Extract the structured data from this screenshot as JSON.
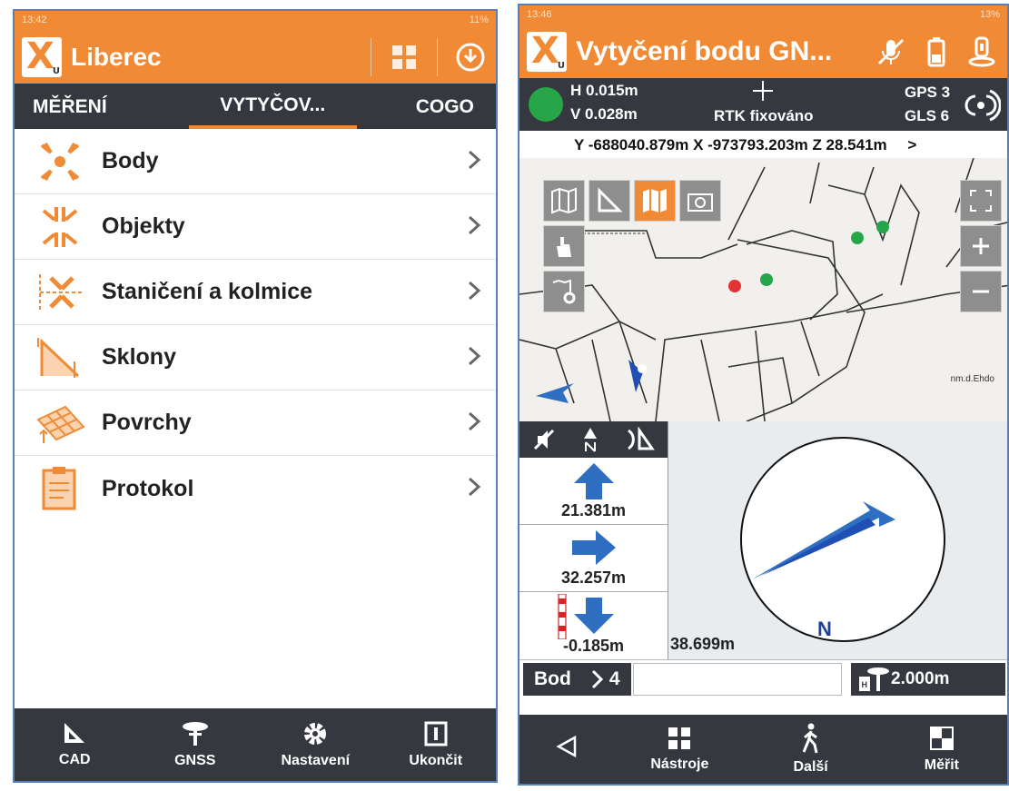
{
  "phone_a": {
    "status": {
      "time": "13:42",
      "battery": "11%"
    },
    "app": {
      "title": "Liberec"
    },
    "tabs": [
      {
        "label": "MĚŘENÍ"
      },
      {
        "label": "VYTYČOV..."
      },
      {
        "label": "COGO"
      }
    ],
    "menu": [
      {
        "label": "Body",
        "icon": "points-icon"
      },
      {
        "label": "Objekty",
        "icon": "objects-icon"
      },
      {
        "label": "Staničení a kolmice",
        "icon": "chainage-icon"
      },
      {
        "label": "Sklony",
        "icon": "slopes-icon"
      },
      {
        "label": "Povrchy",
        "icon": "surfaces-icon"
      },
      {
        "label": "Protokol",
        "icon": "report-icon"
      }
    ],
    "bottom": [
      {
        "label": "CAD"
      },
      {
        "label": "GNSS"
      },
      {
        "label": "Nastavení"
      },
      {
        "label": "Ukončit"
      }
    ]
  },
  "phone_b": {
    "status": {
      "time": "13:46",
      "battery": "13%"
    },
    "app": {
      "title": "Vytyčení bodu GN..."
    },
    "info": {
      "h": "H 0.015m",
      "v": "V 0.028m",
      "fix": "RTK fixováno",
      "gps": "GPS 3",
      "gls": "GLS 6",
      "fix_color": "#27a549"
    },
    "coords": "Y -688040.879m X -973793.203m Z 28.541m",
    "coords_suffix": ">",
    "navigation": {
      "forward": "21.381m",
      "right": "32.257m",
      "down": "-0.185m",
      "distance": "38.699m",
      "compass_label": "N"
    },
    "point": {
      "label": "Bod",
      "value": "4",
      "antenna_height": "2.000m",
      "antenna_label": "H"
    },
    "bottom": [
      {
        "label": ""
      },
      {
        "label": "Nástroje"
      },
      {
        "label": "Další"
      },
      {
        "label": "Měřit"
      }
    ],
    "map": {
      "edge_label": "nm.d.Ehdo"
    }
  },
  "colors": {
    "accent": "#f08a35",
    "dark": "#35383f",
    "nav_blue": "#2e6fc2"
  }
}
